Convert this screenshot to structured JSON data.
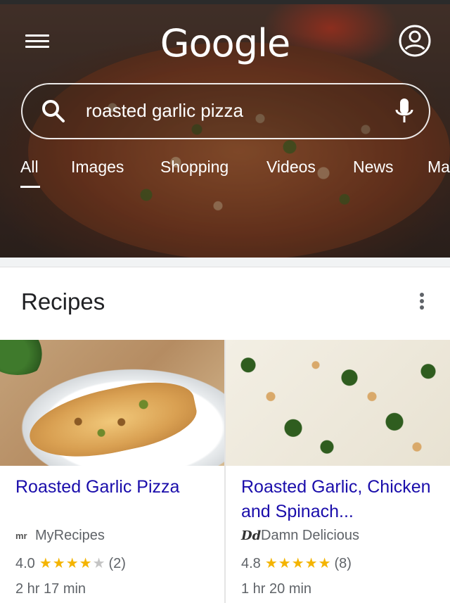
{
  "header": {
    "logo_text": "Google",
    "search": {
      "value": "roasted garlic pizza"
    },
    "tabs": [
      {
        "label": "All",
        "active": true
      },
      {
        "label": "Images"
      },
      {
        "label": "Shopping"
      },
      {
        "label": "Videos"
      },
      {
        "label": "News"
      },
      {
        "label": "Ma"
      }
    ]
  },
  "recipes": {
    "section_title": "Recipes",
    "cards": [
      {
        "title": "Roasted Garlic Pizza",
        "source_logo": "mr",
        "source": "MyRecipes",
        "rating": "4.0",
        "stars_filled": 4,
        "stars_total": 5,
        "review_count": "(2)",
        "time": "2 hr 17 min"
      },
      {
        "title": "Roasted Garlic, Chicken and Spinach...",
        "source_logo": "Dd",
        "source": "Damn Delicious",
        "rating": "4.8",
        "stars_filled": 5,
        "stars_total": 5,
        "review_count": "(8)",
        "time": "1 hr 20 min"
      }
    ]
  },
  "colors": {
    "link": "#1a0dab",
    "star": "#f4b400",
    "muted_text": "#5f6368"
  }
}
